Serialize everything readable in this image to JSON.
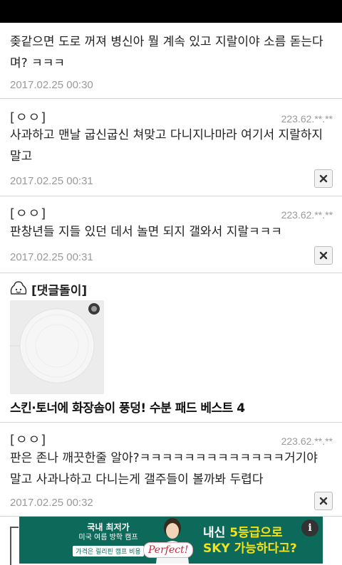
{
  "comments": [
    {
      "author": "",
      "ip": "",
      "text": "좆같으면 도로 꺼져 병신아 뭘 계속 있고 지랄이야 소름 돋는다며? ㅋㅋㅋ",
      "date": "2017.02.25 00:30"
    },
    {
      "author": "[ㅇㅇ]",
      "ip": "223.62.**.**",
      "text": "사과하고 맨날 굽신굽신 쳐맞고 다니지나마라 여기서 지랄하지말고",
      "date": "2017.02.25 00:31"
    },
    {
      "author": "[ㅇㅇ]",
      "ip": "223.62.**.**",
      "text": "판창년들 지들 있던 데서 놀면 되지 갤와서 지랄ㅋㅋㅋ",
      "date": "2017.02.25 00:31"
    },
    {
      "author": "[ㅇㅇ]",
      "ip": "223.62.**.**",
      "text": "판은 존나 깨끗한줄 알아?ㅋㅋㅋㅋㅋㅋㅋㅋㅋㅋㅋㅋㅋ거기야 말고 사과나하고 다니는게 갤주들이 볼까봐 두렵다",
      "date": "2017.02.25 00:32"
    }
  ],
  "ad": {
    "label": "[댓글돌이]",
    "title": "스킨·토너에 화장솜이 풍덩! 수분 패드 베스트 4"
  },
  "banner": {
    "line1": "국내 최저가",
    "line2": "미국 여름 방학 캠프",
    "line3": "가격은 릴리핀 캠프 비용",
    "perfect": "Perfect!",
    "headline_a": "내신 ",
    "headline_b": "5등급으로",
    "headline_c": "SKY 가능하다고?",
    "info": "i"
  },
  "colors": {
    "banner_bg": "#0d6a5a",
    "banner_accent": "#f4e11a",
    "divider": "#d6d6d6",
    "meta_text": "#9a9a9a"
  }
}
